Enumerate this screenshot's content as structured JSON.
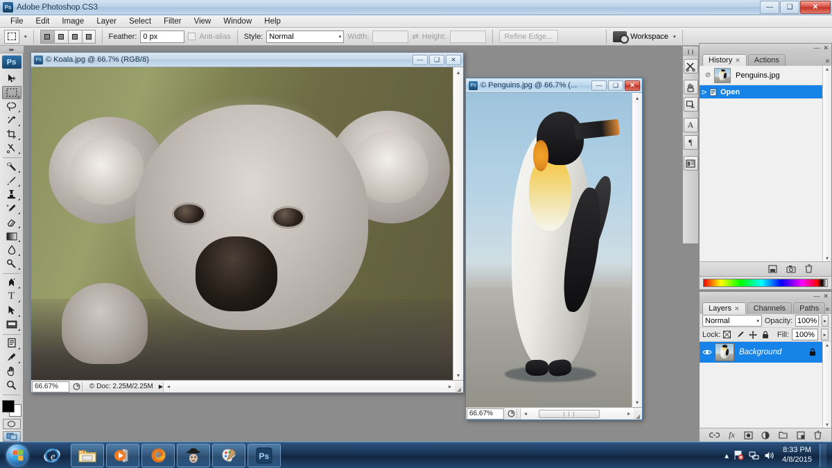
{
  "window": {
    "app_title": "Adobe Photoshop CS3",
    "app_icon": "photoshop-icon",
    "minimize": "—",
    "restore": "❑",
    "close": "✕"
  },
  "menubar": {
    "items": [
      "File",
      "Edit",
      "Image",
      "Layer",
      "Select",
      "Filter",
      "View",
      "Window",
      "Help"
    ]
  },
  "options_bar": {
    "tool_icon": "rectangular-marquee-icon",
    "tool_dropdown_arrow": "▾",
    "selection_modes": [
      "new-selection",
      "add-to-selection",
      "subtract-from-selection",
      "intersect-selection"
    ],
    "feather_label": "Feather:",
    "feather_value": "0 px",
    "antialias_label": "Anti-alias",
    "antialias_checked": false,
    "style_label": "Style:",
    "style_value": "Normal",
    "style_arrow": "▾",
    "width_label": "Width:",
    "width_value": "",
    "swap_icon": "⇄",
    "height_label": "Height:",
    "height_value": "",
    "refine_edge_label": "Refine Edge...",
    "workspace_label": "Workspace",
    "workspace_arrow": "▾"
  },
  "toolbox": {
    "grip": "▸▸",
    "logo": "Ps",
    "tools": [
      {
        "name": "move-tool",
        "glyph": "↖",
        "selected": false
      },
      {
        "name": "rectangular-marquee-tool",
        "glyph": "⬚",
        "selected": true
      },
      {
        "name": "lasso-tool",
        "glyph": "❂",
        "selected": false
      },
      {
        "name": "magic-wand-tool",
        "glyph": "✳",
        "selected": false
      },
      {
        "name": "crop-tool",
        "glyph": "⛏",
        "selected": false
      },
      {
        "name": "slice-tool",
        "glyph": "✂",
        "selected": false
      },
      {
        "name": "healing-brush-tool",
        "glyph": "✐",
        "selected": false
      },
      {
        "name": "brush-tool",
        "glyph": "✎",
        "selected": false
      },
      {
        "name": "clone-stamp-tool",
        "glyph": "✇",
        "selected": false
      },
      {
        "name": "history-brush-tool",
        "glyph": "✒",
        "selected": false
      },
      {
        "name": "eraser-tool",
        "glyph": "▱",
        "selected": false
      },
      {
        "name": "gradient-tool",
        "glyph": "▤",
        "selected": false
      },
      {
        "name": "blur-tool",
        "glyph": "●",
        "selected": false
      },
      {
        "name": "dodge-tool",
        "glyph": "⚲",
        "selected": false
      },
      {
        "name": "pen-tool",
        "glyph": "✒",
        "selected": false
      },
      {
        "name": "type-tool",
        "glyph": "T",
        "selected": false
      },
      {
        "name": "path-selection-tool",
        "glyph": "➤",
        "selected": false
      },
      {
        "name": "rectangle-shape-tool",
        "glyph": "■",
        "selected": false
      },
      {
        "name": "notes-tool",
        "glyph": "▥",
        "selected": false
      },
      {
        "name": "eyedropper-tool",
        "glyph": "✑",
        "selected": false
      },
      {
        "name": "hand-tool",
        "glyph": "✋",
        "selected": false
      },
      {
        "name": "zoom-tool",
        "glyph": "⚲",
        "selected": false
      }
    ],
    "swap_colors_icon": "↱",
    "foreground_color": "#000000",
    "background_color": "#ffffff",
    "quick_mask_name": "quick-mask-mode",
    "screen_mode_name": "screen-mode-toggle"
  },
  "documents": [
    {
      "id": "koala",
      "title": "© Koala.jpg @ 66.7% (RGB/8)",
      "active": false,
      "zoom": "66.67%",
      "doc_info": "© Doc: 2.25M/2.25M",
      "status_arrow": "▶",
      "minimize": "—",
      "restore": "❑",
      "close": "✕",
      "scroll_left": "◂",
      "scroll_right": "▸",
      "scroll_up": "▴",
      "scroll_down": "▾"
    },
    {
      "id": "penguins",
      "title": "© Penguins.jpg @ 66.7% (...",
      "active": true,
      "zoom": "66.67%",
      "doc_info": "",
      "minimize": "—",
      "restore": "❑",
      "close": "✕",
      "thumb_grip": "❘❘❘",
      "scroll_left": "◂",
      "scroll_right": "▸",
      "scroll_up": "▴",
      "scroll_down": "▾"
    }
  ],
  "dock_collapsed": {
    "grip": "❙❙",
    "icons": [
      {
        "name": "tool-presets-icon",
        "glyph": "✄"
      },
      {
        "name": "brushes-icon",
        "glyph": "⚘"
      },
      {
        "name": "clone-source-icon",
        "glyph": "⎙"
      },
      {
        "name": "character-panel-icon",
        "glyph": "A"
      },
      {
        "name": "paragraph-panel-icon",
        "glyph": "¶"
      },
      {
        "name": "layer-comps-icon",
        "glyph": "▤"
      }
    ]
  },
  "history_panel": {
    "minimize": "—",
    "close": "✕",
    "menu_icon": "≡",
    "tabs": [
      {
        "label": "History",
        "active": true,
        "closable": true
      },
      {
        "label": "Actions",
        "active": false,
        "closable": false
      }
    ],
    "snapshot": {
      "label": "Penguins.jpg",
      "brush_cell": "⊘"
    },
    "states": [
      {
        "label": "Open",
        "selected": true,
        "icon": "☰",
        "arrow": "▷"
      }
    ],
    "footer_icons": [
      {
        "name": "new-document-from-state-icon",
        "glyph": "▣"
      },
      {
        "name": "create-new-snapshot-icon",
        "glyph": "◱"
      },
      {
        "name": "delete-state-icon",
        "glyph": "Ὕ1"
      }
    ],
    "scroll_up": "▴",
    "scroll_down": "▾"
  },
  "color_strip": {
    "name": "color-ramp"
  },
  "layers_panel": {
    "minimize": "—",
    "close": "✕",
    "menu_icon": "≡",
    "tabs": [
      {
        "label": "Layers",
        "active": true,
        "closable": true
      },
      {
        "label": "Channels",
        "active": false,
        "closable": false
      },
      {
        "label": "Paths",
        "active": false,
        "closable": false
      }
    ],
    "blend_mode": "Normal",
    "blend_arrow": "▾",
    "opacity_label": "Opacity:",
    "opacity_value": "100%",
    "lock_label": "Lock:",
    "lock_icons": [
      {
        "name": "lock-transparent-pixels-icon",
        "glyph": "▨"
      },
      {
        "name": "lock-image-pixels-icon",
        "glyph": "✎"
      },
      {
        "name": "lock-position-icon",
        "glyph": "✛"
      },
      {
        "name": "lock-all-icon",
        "glyph": "ὑ2"
      }
    ],
    "fill_label": "Fill:",
    "fill_value": "100%",
    "stepper_arrow": "▸",
    "layers": [
      {
        "name": "Background",
        "visible": true,
        "locked": true,
        "selected": true,
        "eye_icon": "◉",
        "lock_icon": "ὑ2"
      }
    ],
    "footer_icons": [
      {
        "name": "link-layers-icon",
        "glyph": "⚭"
      },
      {
        "name": "layer-style-icon",
        "glyph": "fx"
      },
      {
        "name": "layer-mask-icon",
        "glyph": "▣"
      },
      {
        "name": "adjustment-layer-icon",
        "glyph": "◑"
      },
      {
        "name": "new-group-icon",
        "glyph": "▱"
      },
      {
        "name": "new-layer-icon",
        "glyph": "⧉"
      },
      {
        "name": "delete-layer-icon",
        "glyph": "Ὕ1"
      }
    ],
    "scroll_up": "▴",
    "scroll_down": "▾"
  },
  "taskbar": {
    "start_button": "start-orb",
    "apps": [
      {
        "name": "internet-explorer-icon",
        "glyph": "e",
        "pinned": false
      },
      {
        "name": "windows-explorer-icon",
        "glyph": "🗁",
        "pinned": true
      },
      {
        "name": "windows-media-player-icon",
        "glyph": "▶",
        "pinned": true
      },
      {
        "name": "firefox-icon",
        "glyph": "🦊",
        "pinned": true
      },
      {
        "name": "spy-app-icon",
        "glyph": "🕵",
        "pinned": true
      },
      {
        "name": "paint-icon",
        "glyph": "🎨",
        "pinned": true
      },
      {
        "name": "photoshop-taskbar-icon",
        "glyph": "Ps",
        "pinned": true
      }
    ],
    "tray": {
      "overflow_arrow": "▴",
      "icons": [
        {
          "name": "action-center-flag-icon",
          "glyph": "⚑"
        },
        {
          "name": "network-icon",
          "glyph": "🖧"
        },
        {
          "name": "volume-icon",
          "glyph": "🔊"
        }
      ],
      "time": "8:33 PM",
      "date": "4/8/2015"
    }
  }
}
